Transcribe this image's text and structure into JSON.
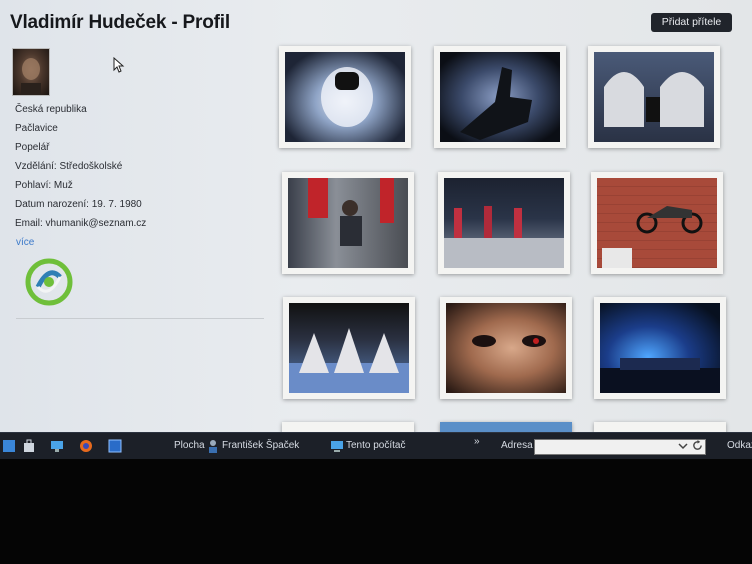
{
  "profile": {
    "title": "Vladimír Hudeček - Profil",
    "add_friend_label": "Přidat přítele",
    "country": "Česká republika",
    "city": "Pačlavice",
    "occupation": "Popelář",
    "education": "Vzdělání: Středoškolské",
    "gender": "Pohlaví: Muž",
    "birthdate": "Datum narození: 19. 7. 1980",
    "email": "Email: vhumanik@seznam.cz",
    "more_label": "více"
  },
  "taskbar": {
    "desktop_label": "Plocha",
    "user_label": "František Špaček",
    "computer_label": "Tento počítač",
    "chevron_label": "»",
    "address_label": "Adresa",
    "links_label": "Odkaz"
  },
  "colors": {
    "accent_link": "#3b79c9",
    "button_bg": "#20242b",
    "logo_green": "#6fbf3a",
    "logo_blue": "#2f7fb5"
  }
}
